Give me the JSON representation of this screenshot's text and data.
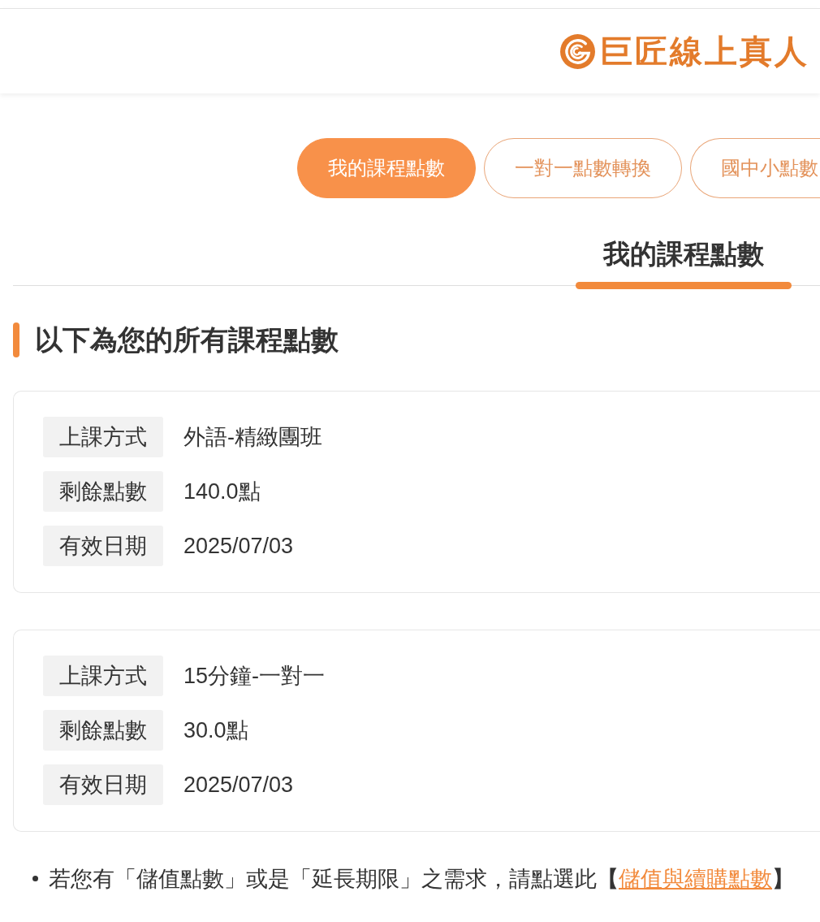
{
  "header": {
    "brand": "巨匠線上真人"
  },
  "tabs": [
    {
      "label": "我的課程點數",
      "selected": true
    },
    {
      "label": "一對一點數轉換",
      "selected": false
    },
    {
      "label": "國中小點數",
      "selected": false
    }
  ],
  "section_tabs": [
    {
      "label": "我的課程點數",
      "selected": true
    }
  ],
  "heading": "以下為您的所有課程點數",
  "cards": [
    {
      "rows": [
        {
          "label": "上課方式",
          "value": "外語-精緻團班"
        },
        {
          "label": "剩餘點數",
          "value": "140.0點"
        },
        {
          "label": "有效日期",
          "value": "2025/07/03"
        }
      ]
    },
    {
      "rows": [
        {
          "label": "上課方式",
          "value": "15分鐘-一對一"
        },
        {
          "label": "剩餘點數",
          "value": "30.0點"
        },
        {
          "label": "有效日期",
          "value": "2025/07/03"
        }
      ]
    }
  ],
  "notes": [
    {
      "text": "若您有「儲值點數」或是「延長期限」之需求，請點選此**【**",
      "link": "儲值與續購點數",
      "after": "**】**"
    }
  ]
}
